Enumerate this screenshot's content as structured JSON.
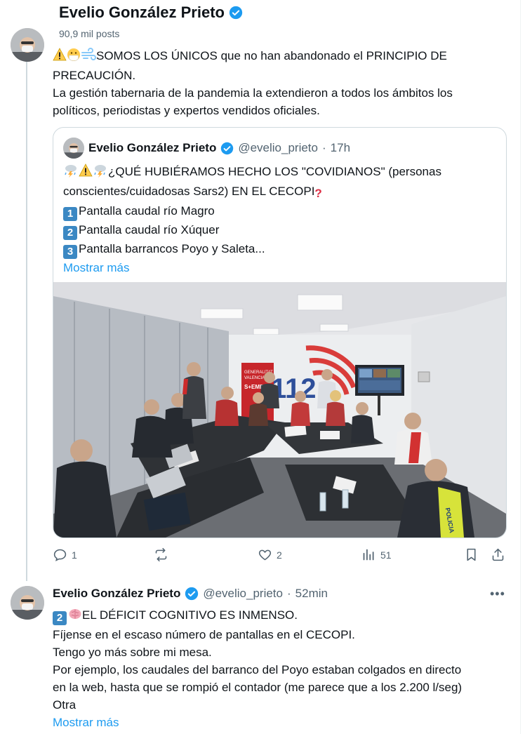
{
  "header": {
    "name": "Evelio González Prieto",
    "posts": "90,9 mil posts"
  },
  "tweet1": {
    "lines": [
      "SOMOS LOS ÚNICOS que no han abandonado el PRINCIPIO DE",
      "PRECAUCIÓN.",
      "La gestión tabernaria de la pandemia la extendieron a todos los ámbitos los",
      "políticos, periodistas y expertos vendidos oficiales."
    ],
    "quote": {
      "name": "Evelio González Prieto",
      "handle": "@evelio_prieto",
      "separator": "·",
      "time": "17h",
      "line1": "¿QUÉ HUBIÉRAMOS HECHO LOS \"COVIDIANOS\" (personas",
      "line2": "conscientes/cuidadosas Sars2) EN EL CECOPI",
      "items": [
        {
          "num": "1",
          "text": "Pantalla caudal río Magro"
        },
        {
          "num": "2",
          "text": "Pantalla caudal río Xúquer"
        },
        {
          "num": "3",
          "text": "Pantalla barrancos Poyo y Saleta..."
        }
      ],
      "show_more": "Mostrar más",
      "image_text": {
        "sign": "112",
        "banner1": "GENERALITAT",
        "banner2": "VALENCIANA",
        "banner3": "S+EME",
        "vest": "POLICIA"
      }
    },
    "actions": {
      "replies": "1",
      "likes": "2",
      "views": "51"
    }
  },
  "tweet2": {
    "name": "Evelio González Prieto",
    "handle": "@evelio_prieto",
    "separator": "·",
    "time": "52min",
    "num": "2",
    "lines": [
      "EL DÉFICIT COGNITIVO ES INMENSO.",
      "Fíjense en el escaso número de pantallas en el CECOPI.",
      "Tengo yo más sobre mi mesa.",
      "Por ejemplo, los caudales del barranco del Poyo estaban colgados en directo",
      "en la web, hasta que se rompió el contador (me parece que a los 2.200 l/seg)",
      "Otra"
    ],
    "show_more": "Mostrar más",
    "more": "•••"
  },
  "colors": {
    "accent": "#1d9bf0",
    "verified": "#1d9bf0",
    "muted": "#536471",
    "border": "#cfd9de",
    "text": "#0f1419"
  }
}
